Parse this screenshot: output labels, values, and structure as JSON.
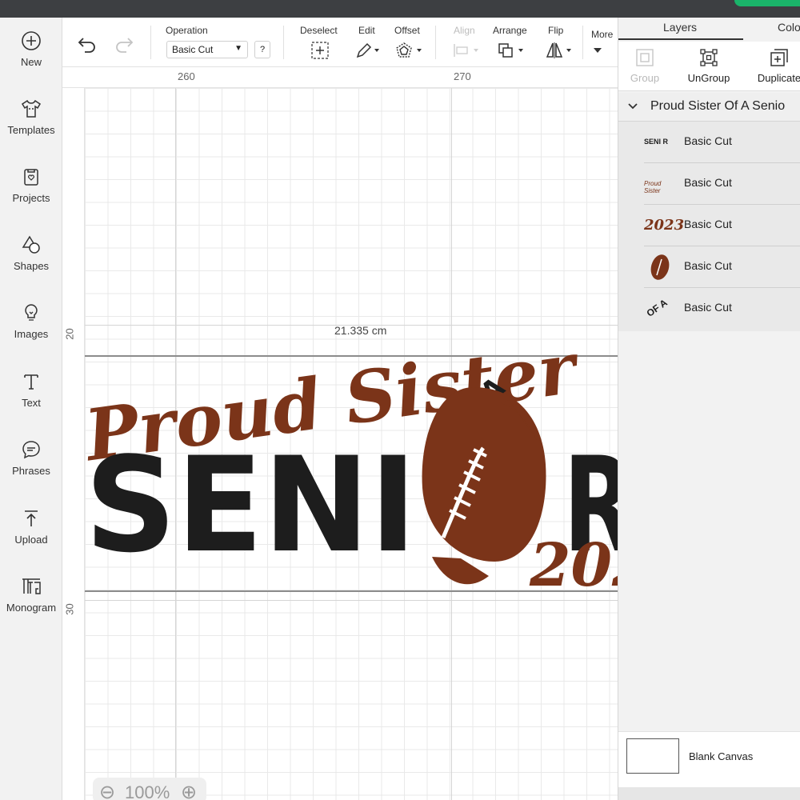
{
  "left_nav": [
    {
      "label": "New",
      "icon": "plus-circle-icon"
    },
    {
      "label": "Templates",
      "icon": "shirt-icon"
    },
    {
      "label": "Projects",
      "icon": "projects-icon"
    },
    {
      "label": "Shapes",
      "icon": "shapes-icon"
    },
    {
      "label": "Images",
      "icon": "lightbulb-icon"
    },
    {
      "label": "Text",
      "icon": "text-icon"
    },
    {
      "label": "Phrases",
      "icon": "chat-bubble-icon"
    },
    {
      "label": "Upload",
      "icon": "upload-icon"
    },
    {
      "label": "Monogram",
      "icon": "monogram-icon"
    }
  ],
  "toolbar": {
    "operation_label": "Operation",
    "operation_value": "Basic Cut",
    "help": "?",
    "deselect": "Deselect",
    "edit": "Edit",
    "offset": "Offset",
    "align": "Align",
    "arrange": "Arrange",
    "flip": "Flip",
    "more": "More"
  },
  "ruler": {
    "top": [
      "260",
      "270"
    ],
    "left": [
      "20",
      "30"
    ]
  },
  "canvas": {
    "dimension": "21.335 cm",
    "zoom": "100%"
  },
  "design": {
    "script_text": "Proud Sister",
    "of_a": "OF A",
    "block_text": "SENI",
    "block_letter": "R",
    "year": "202",
    "colors": {
      "brown": "#7b3419",
      "black": "#1d1d1d"
    }
  },
  "right_panel": {
    "tabs": [
      "Layers",
      "Colo"
    ],
    "tools": {
      "group": "Group",
      "ungroup": "UnGroup",
      "duplicate": "Duplicate"
    },
    "group_name": "Proud Sister Of A Senio",
    "layers": [
      {
        "name": "Basic Cut",
        "thumb": "SENI R"
      },
      {
        "name": "Basic Cut",
        "thumb": "Proud Sister"
      },
      {
        "name": "Basic Cut",
        "thumb": "2023"
      },
      {
        "name": "Basic Cut",
        "thumb": "football"
      },
      {
        "name": "Basic Cut",
        "thumb": "OF A"
      }
    ],
    "blank_canvas": "Blank Canvas"
  }
}
